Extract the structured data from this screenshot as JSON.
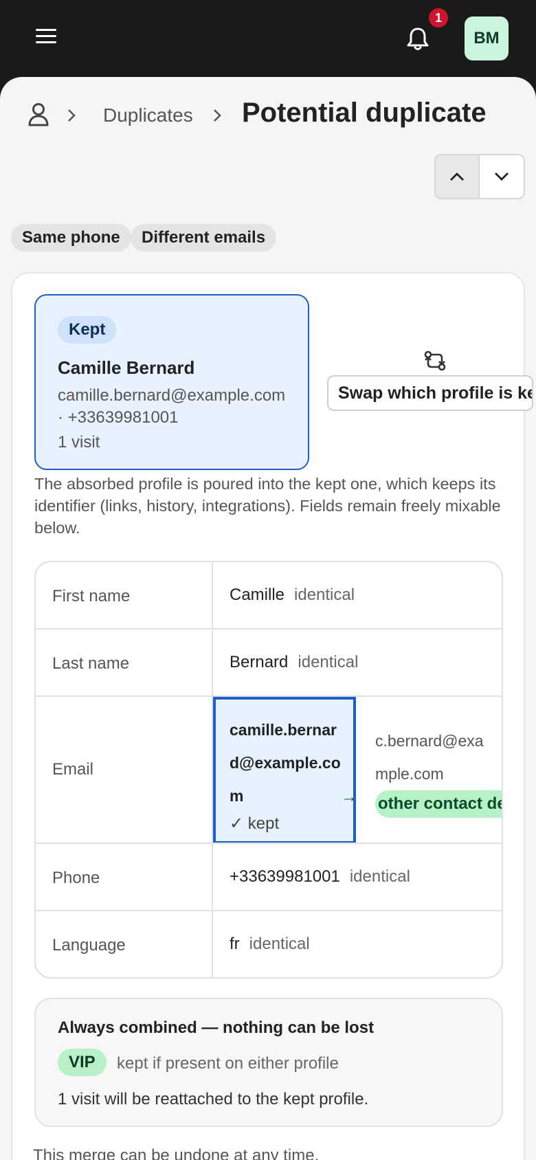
{
  "topbar": {
    "notification_count": "1",
    "avatar_initials": "BM"
  },
  "breadcrumb": {
    "link": "Duplicates",
    "title": "Potential duplicate"
  },
  "chips": [
    "Same phone",
    "Different emails"
  ],
  "kept_profile": {
    "label": "Kept",
    "name": "Camille Bernard",
    "email": "camille.bernard@example.com",
    "phone": "· +33639981001",
    "visits": "1 visit"
  },
  "swap": {
    "label": "Swap which profile is kept"
  },
  "description": "The absorbed profile is poured into the kept one, which keeps its identifier (links, history, integrations). Fields remain freely mixable below.",
  "fields": {
    "first_name": {
      "label": "First name",
      "value": "Camille",
      "status": "identical"
    },
    "last_name": {
      "label": "Last name",
      "value": "Bernard",
      "status": "identical"
    },
    "email": {
      "label": "Email",
      "kept_value": "camille.bernard@example.com",
      "kept_tag": "✓ kept",
      "other_value": "c.bernard@example.com",
      "arrow": "→",
      "other_tag": "other contact details"
    },
    "phone": {
      "label": "Phone",
      "value": "+33639981001",
      "status": "identical"
    },
    "language": {
      "label": "Language",
      "value": "fr",
      "status": "identical"
    }
  },
  "always_combined": {
    "title": "Always combined — nothing can be lost",
    "vip_label": "VIP",
    "vip_text": "kept if present on either profile",
    "visit_text": "1 visit will be reattached to the kept profile."
  },
  "footer_note": "This merge can be undone at any time.",
  "colors": {
    "accent": "#1a5fc8",
    "kept_bg": "#e8f2fe",
    "green_chip": "#b8f1c8",
    "badge": "#d0142c",
    "avatar_bg": "#c9f5dc"
  }
}
